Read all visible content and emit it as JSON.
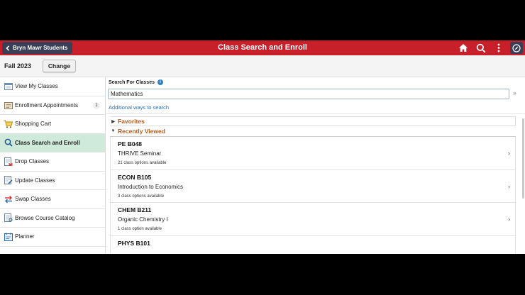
{
  "header": {
    "back_label": "Bryn Mawr Students",
    "title": "Class Search and Enroll",
    "icons": [
      "home-icon",
      "search-icon",
      "more-vert-icon",
      "navbar-compass-icon"
    ]
  },
  "term": {
    "label": "Fall 2023",
    "change_label": "Change"
  },
  "sidebar": {
    "items": [
      {
        "label": "View My Classes",
        "icon": "calendar-icon"
      },
      {
        "label": "Enrollment Appointments",
        "icon": "appointments-icon",
        "badge": "1"
      },
      {
        "label": "Shopping Cart",
        "icon": "cart-icon"
      },
      {
        "label": "Class Search and Enroll",
        "icon": "search-icon",
        "active": true
      },
      {
        "label": "Drop Classes",
        "icon": "drop-icon"
      },
      {
        "label": "Update Classes",
        "icon": "update-icon"
      },
      {
        "label": "Swap Classes",
        "icon": "swap-icon"
      },
      {
        "label": "Browse Course Catalog",
        "icon": "catalog-icon"
      },
      {
        "label": "Planner",
        "icon": "planner-icon"
      }
    ]
  },
  "search": {
    "label": "Search For Classes",
    "info": "i",
    "value": "Mathematics",
    "go_symbol": "»",
    "additional_link": "Additional ways to search"
  },
  "favorites": {
    "label": "Favorites"
  },
  "recent": {
    "label": "Recently Viewed",
    "items": [
      {
        "code": "PE B048",
        "title": "THRIVE Seminar",
        "options": "21 class options available"
      },
      {
        "code": "ECON B105",
        "title": "Introduction to Economics",
        "options": "3 class options available"
      },
      {
        "code": "CHEM B211",
        "title": "Organic Chemistry I",
        "options": "1 class option available"
      },
      {
        "code": "PHYS B101",
        "title": "",
        "options": ""
      }
    ]
  },
  "colors": {
    "header_red": "#c8202a",
    "button_navy": "#3a3f58",
    "active_green": "#cfe9da",
    "section_orange": "#b35c1e",
    "link_blue": "#2f6fb0"
  }
}
